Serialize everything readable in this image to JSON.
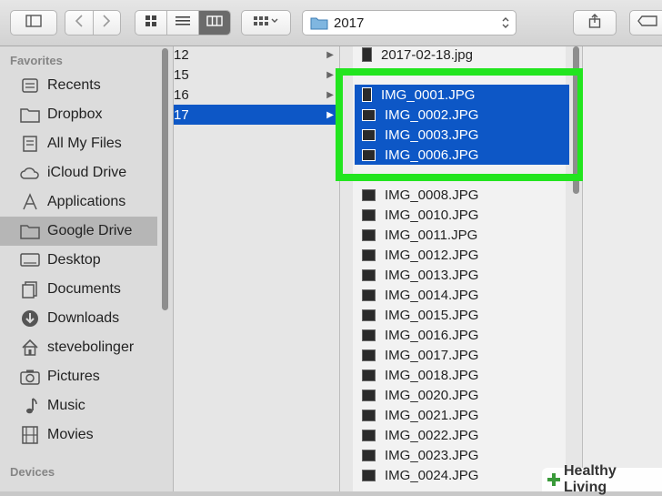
{
  "toolbar": {
    "path_label": "2017",
    "icons": [
      "sidebar-icon",
      "back-icon",
      "forward-icon",
      "icon-view-icon",
      "list-view-icon",
      "column-view-icon",
      "arrange-icon",
      "folder-icon",
      "share-icon",
      "tag-icon"
    ]
  },
  "sidebar": {
    "favorites_label": "Favorites",
    "devices_label": "Devices",
    "items": [
      {
        "label": "Recents",
        "icon": "recents-icon"
      },
      {
        "label": "Dropbox",
        "icon": "folder-icon"
      },
      {
        "label": "All My Files",
        "icon": "all-files-icon"
      },
      {
        "label": "iCloud Drive",
        "icon": "cloud-icon"
      },
      {
        "label": "Applications",
        "icon": "applications-icon"
      },
      {
        "label": "Google Drive",
        "icon": "folder-icon"
      },
      {
        "label": "Desktop",
        "icon": "desktop-icon"
      },
      {
        "label": "Documents",
        "icon": "documents-icon"
      },
      {
        "label": "Downloads",
        "icon": "downloads-icon"
      },
      {
        "label": "stevebolinger",
        "icon": "home-icon"
      },
      {
        "label": "Pictures",
        "icon": "camera-icon"
      },
      {
        "label": "Music",
        "icon": "music-icon"
      },
      {
        "label": "Movies",
        "icon": "film-icon"
      }
    ],
    "selected_index": 5
  },
  "column1": {
    "rows": [
      "12",
      "15",
      "16",
      "17"
    ],
    "selected_index": 3
  },
  "column2": {
    "files": [
      "2017-02-18.jpg",
      "IMG_0001.JPG",
      "IMG_0002.JPG",
      "IMG_0003.JPG",
      "IMG_0006.JPG",
      "IMG_0008.JPG",
      "IMG_0010.JPG",
      "IMG_0011.JPG",
      "IMG_0012.JPG",
      "IMG_0013.JPG",
      "IMG_0014.JPG",
      "IMG_0015.JPG",
      "IMG_0016.JPG",
      "IMG_0017.JPG",
      "IMG_0018.JPG",
      "IMG_0020.JPG",
      "IMG_0021.JPG",
      "IMG_0022.JPG",
      "IMG_0023.JPG",
      "IMG_0024.JPG"
    ],
    "selected_indices": [
      1,
      2,
      3,
      4
    ]
  },
  "watermark": {
    "text": "Healthy Living"
  },
  "colors": {
    "selection": "#0d57c6",
    "highlight": "#22e51f",
    "watermark_green": "#3a9a3a"
  }
}
